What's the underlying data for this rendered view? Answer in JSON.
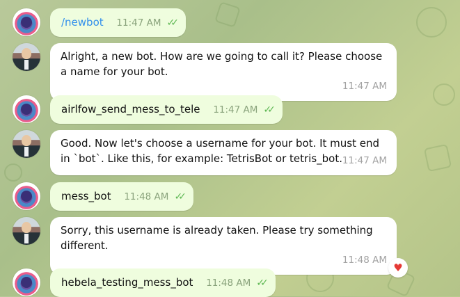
{
  "colors": {
    "outgoing_bubble": "#effdde",
    "incoming_bubble": "#ffffff",
    "read_ticks": "#5fb854",
    "command_link": "#3390ec",
    "reaction_heart": "#e53935"
  },
  "messages": [
    {
      "sender": "user",
      "text": "/newbot",
      "time": "11:47 AM",
      "status": "double-check-icon",
      "is_command": true
    },
    {
      "sender": "bot",
      "text": "Alright, a new bot. How are we going to call it? Please choose a name for your bot.",
      "time": "11:47 AM"
    },
    {
      "sender": "user",
      "text": "airlfow_send_mess_to_tele",
      "time": "11:47 AM",
      "status": "double-check-icon"
    },
    {
      "sender": "bot",
      "text": "Good. Now let's choose a username for your bot. It must end in `bot`. Like this, for example: TetrisBot or tetris_bot.",
      "time": "11:47 AM"
    },
    {
      "sender": "user",
      "text": "mess_bot",
      "time": "11:48 AM",
      "status": "double-check-icon"
    },
    {
      "sender": "bot",
      "text": "Sorry, this username is already taken. Please try something different.",
      "time": "11:48 AM",
      "reaction": "heart-icon"
    },
    {
      "sender": "user",
      "text": "hebela_testing_mess_bot",
      "time": "11:48 AM",
      "status": "double-check-icon"
    }
  ]
}
